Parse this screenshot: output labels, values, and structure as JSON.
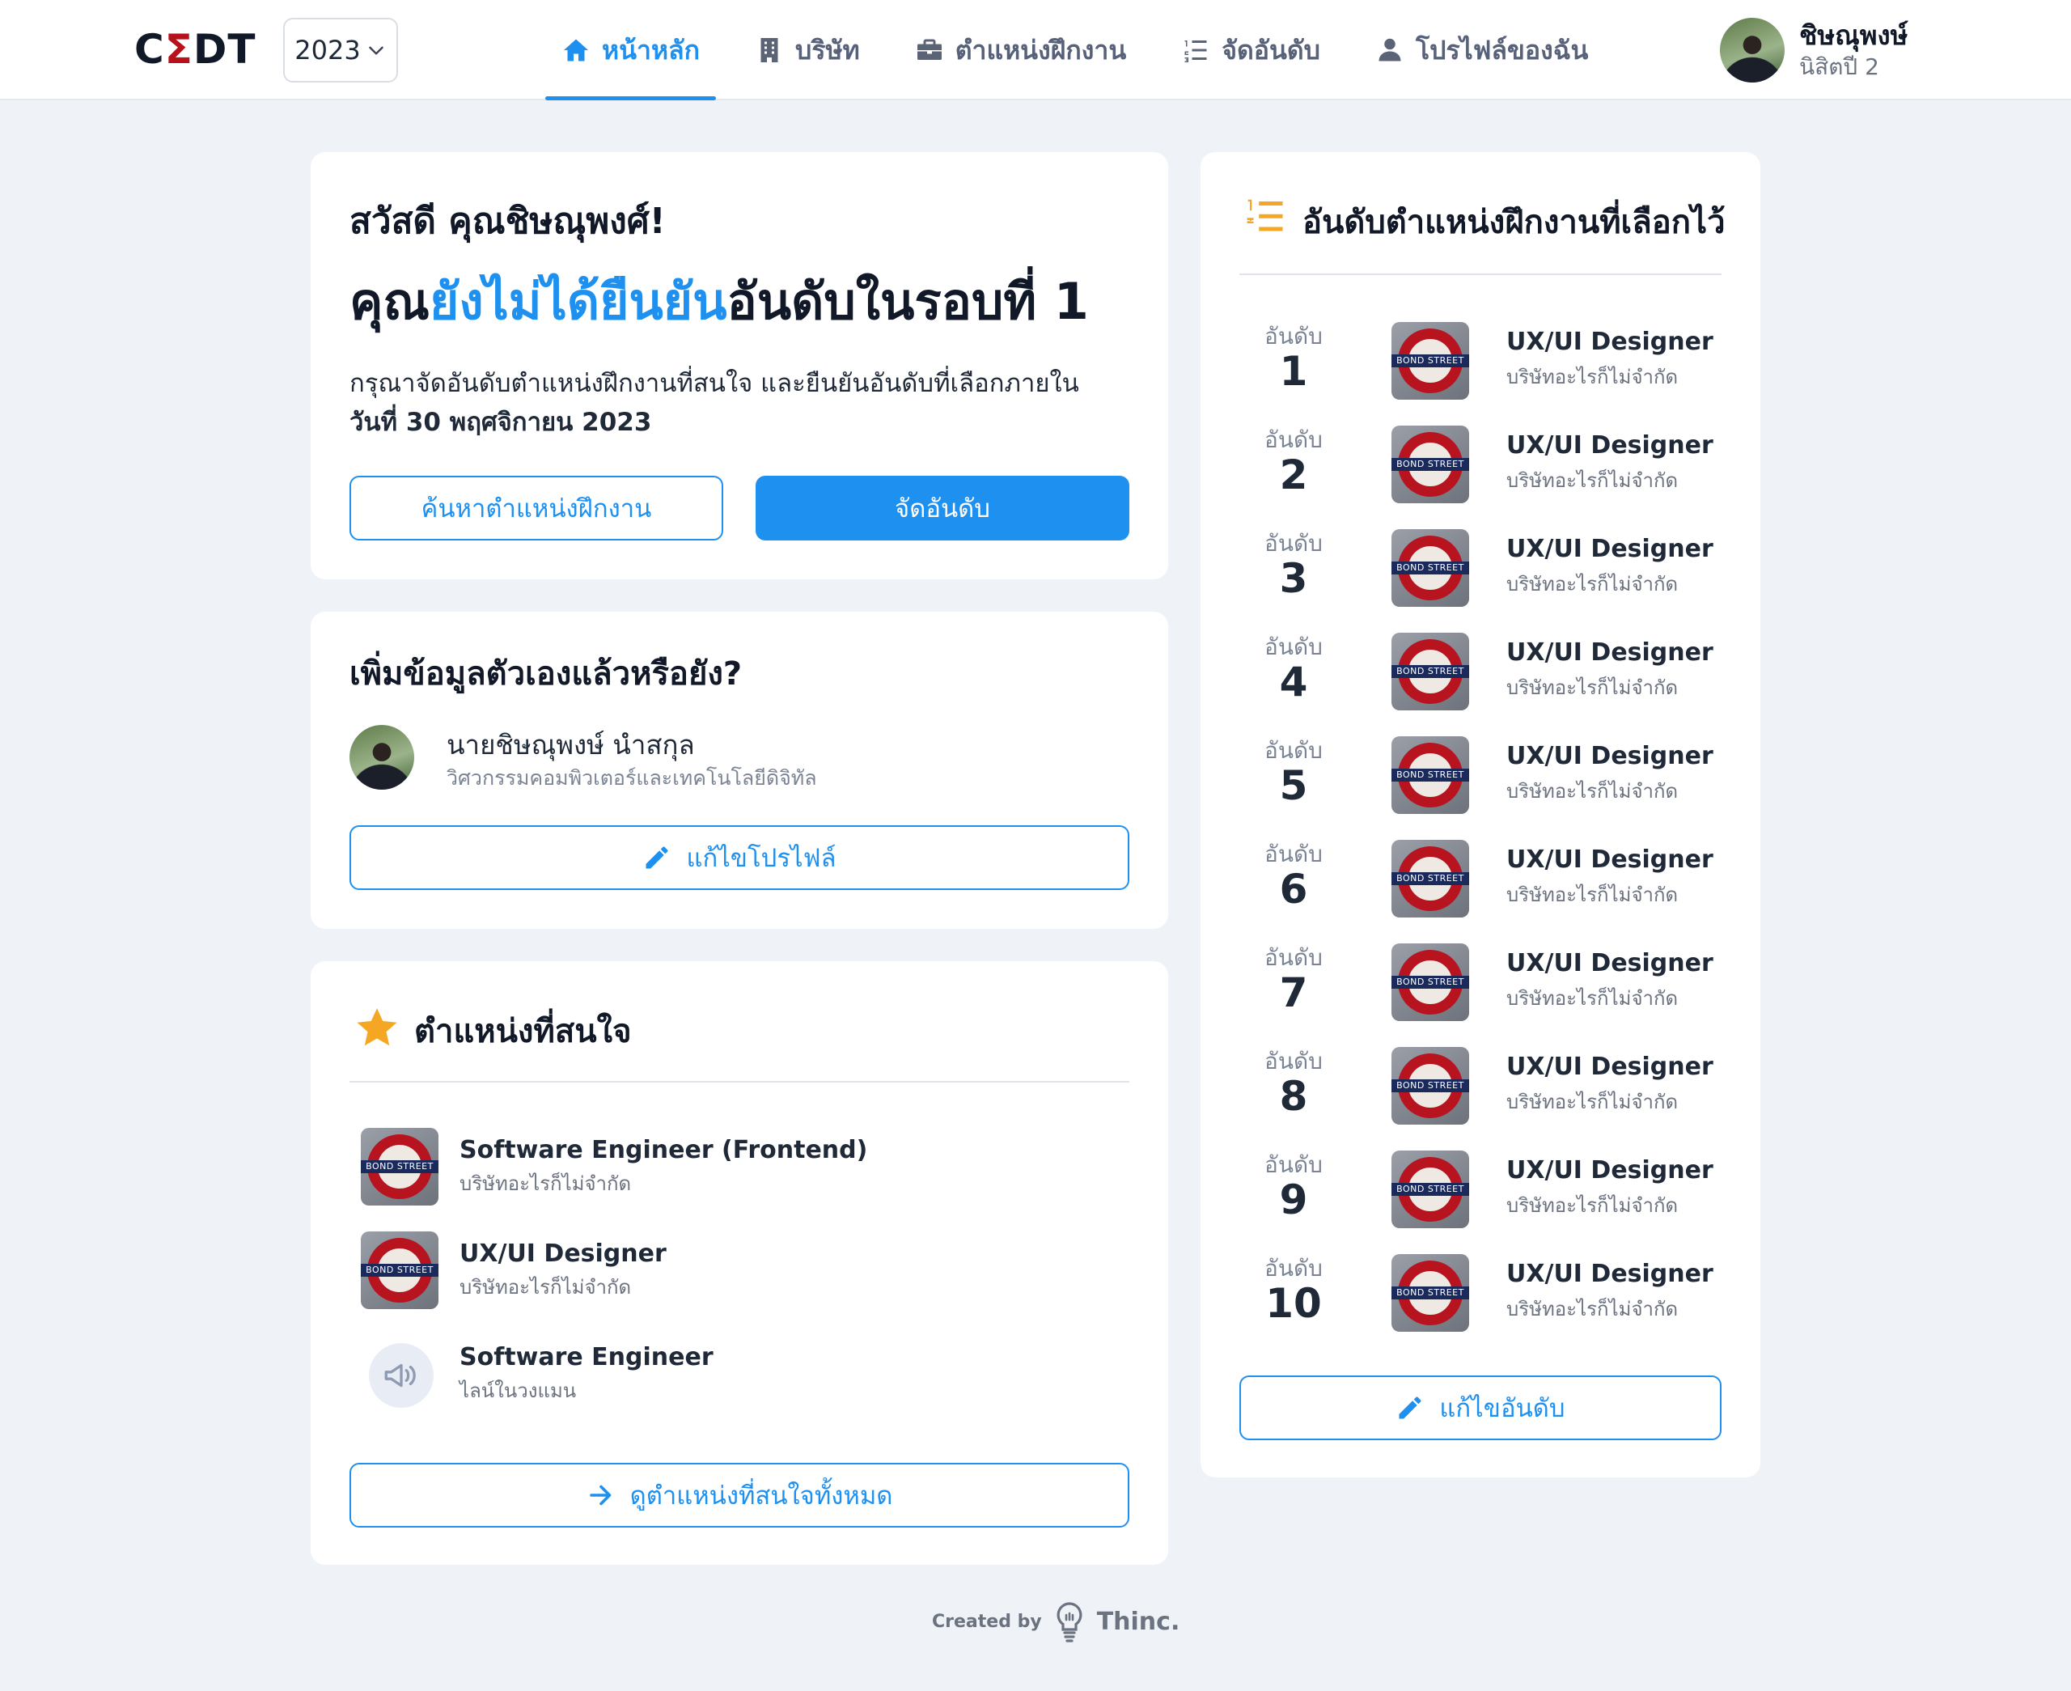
{
  "header": {
    "logo_text": [
      "C",
      "Σ",
      "DT"
    ],
    "year": "2023",
    "nav": [
      {
        "label": "หน้าหลัก",
        "icon": "home-icon",
        "active": true
      },
      {
        "label": "บริษัท",
        "icon": "building-icon",
        "active": false
      },
      {
        "label": "ตำแหน่งฝึกงาน",
        "icon": "briefcase-icon",
        "active": false
      },
      {
        "label": "จัดอันดับ",
        "icon": "ranking-list-icon",
        "active": false
      },
      {
        "label": "โปรไฟล์ของฉัน",
        "icon": "user-icon",
        "active": false
      }
    ],
    "user": {
      "name": "ชิษณุพงษ์",
      "sub": "นิสิตปี 2"
    }
  },
  "hero": {
    "greeting": "สวัสดี คุณชิษณุพงศ์!",
    "status_prefix": "คุณ",
    "status_highlight": "ยังไม่ได้ยืนยัน",
    "status_suffix": "อันดับในรอบที่ 1",
    "desc_text": "กรุณาจัดอันดับตำแหน่งฝึกงานที่สนใจ และยืนยันอันดับที่เลือกภายใน",
    "deadline": "วันที่ 30 พฤศจิกายน 2023",
    "search_button": "ค้นหาตำแหน่งฝึกงาน",
    "rank_button": "จัดอันดับ"
  },
  "profile": {
    "title": "เพิ่มข้อมูลตัวเองแล้วหรือยัง?",
    "name": "นายชิษณุพงษ์ นำสกุล",
    "faculty": "วิศวกรรมคอมพิวเตอร์และเทคโนโลยีดิจิทัล",
    "edit_button": "แก้ไขโปรไฟล์"
  },
  "interests": {
    "title": "ตำแหน่งที่สนใจ",
    "items": [
      {
        "title": "Software Engineer (Frontend)",
        "company": "บริษัทอะไรก็ไม่จำกัด",
        "logo": "BOND STREET"
      },
      {
        "title": "UX/UI Designer",
        "company": "บริษัทอะไรก็ไม่จำกัด",
        "logo": "BOND STREET"
      },
      {
        "title": "Software Engineer",
        "company": "ไลน์ในวงแมน",
        "logo": "megaphone-icon"
      }
    ],
    "view_all_button": "ดูตำแหน่งที่สนใจทั้งหมด"
  },
  "ranking": {
    "title": "อันดับตำแหน่งฝึกงานที่เลือกไว้",
    "rank_label": "อันดับ",
    "items": [
      {
        "rank": "1",
        "title": "UX/UI Designer",
        "company": "บริษัทอะไรก็ไม่จำกัด",
        "logo": "BOND STREET"
      },
      {
        "rank": "2",
        "title": "UX/UI Designer",
        "company": "บริษัทอะไรก็ไม่จำกัด",
        "logo": "BOND STREET"
      },
      {
        "rank": "3",
        "title": "UX/UI Designer",
        "company": "บริษัทอะไรก็ไม่จำกัด",
        "logo": "BOND STREET"
      },
      {
        "rank": "4",
        "title": "UX/UI Designer",
        "company": "บริษัทอะไรก็ไม่จำกัด",
        "logo": "BOND STREET"
      },
      {
        "rank": "5",
        "title": "UX/UI Designer",
        "company": "บริษัทอะไรก็ไม่จำกัด",
        "logo": "BOND STREET"
      },
      {
        "rank": "6",
        "title": "UX/UI Designer",
        "company": "บริษัทอะไรก็ไม่จำกัด",
        "logo": "BOND STREET"
      },
      {
        "rank": "7",
        "title": "UX/UI Designer",
        "company": "บริษัทอะไรก็ไม่จำกัด",
        "logo": "BOND STREET"
      },
      {
        "rank": "8",
        "title": "UX/UI Designer",
        "company": "บริษัทอะไรก็ไม่จำกัด",
        "logo": "BOND STREET"
      },
      {
        "rank": "9",
        "title": "UX/UI Designer",
        "company": "บริษัทอะไรก็ไม่จำกัด",
        "logo": "BOND STREET"
      },
      {
        "rank": "10",
        "title": "UX/UI Designer",
        "company": "บริษัทอะไรก็ไม่จำกัด",
        "logo": "BOND STREET"
      }
    ],
    "edit_button": "แก้ไขอันดับ"
  },
  "footer": {
    "created_by": "Created by",
    "brand": "Thinc."
  },
  "colors": {
    "accent": "#1e90ef",
    "background": "#eff2f7",
    "star": "#f5a623",
    "logo_red": "#b5121b"
  }
}
